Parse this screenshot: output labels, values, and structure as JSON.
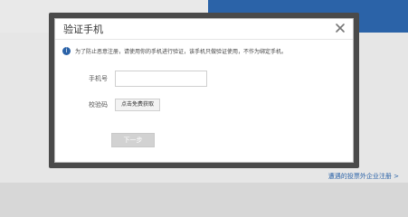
{
  "background": {
    "bottom_link": "遭遇的投票外企业注册 >"
  },
  "modal": {
    "title": "验证手机",
    "close_icon": "close-icon",
    "notice_icon": "info-icon",
    "notice_text": "为了防止恶意注册，请使用你的手机进行验证，该手机只做验证使用，不作为绑定手机。",
    "phone": {
      "label": "手机号",
      "value": "",
      "placeholder": ""
    },
    "code": {
      "label": "校验码",
      "button": "点击免费获取"
    },
    "next_button": "下一步"
  },
  "colors": {
    "accent_blue": "#2b63a8",
    "overlay": "#4a4a4a",
    "disabled_button": "#d2d2d2"
  }
}
